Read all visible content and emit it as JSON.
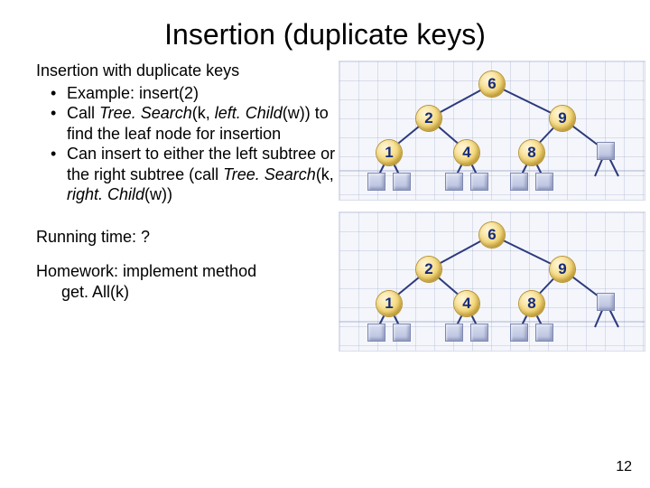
{
  "title": "Insertion (duplicate keys)",
  "subheader": "Insertion with duplicate keys",
  "bullet1": "Example: insert(2)",
  "bullet2_a": "Call ",
  "bullet2_b": "Tree. Search",
  "bullet2_c": "(k, ",
  "bullet2_d": "left. Child",
  "bullet2_e": "(w)) to find the leaf node for insertion",
  "bullet3_a": "Can insert to either the left subtree or the right subtree (call ",
  "bullet3_b": "Tree. Search",
  "bullet3_c": "(k, ",
  "bullet3_d": "right. Child",
  "bullet3_e": "(w))",
  "running": "Running time: ?",
  "hw1": "Homework: implement method",
  "hw2": "get. All(k)",
  "pagenum": "12",
  "tree": {
    "n6": "6",
    "n2": "2",
    "n9": "9",
    "n1": "1",
    "n4": "4",
    "n8": "8"
  }
}
